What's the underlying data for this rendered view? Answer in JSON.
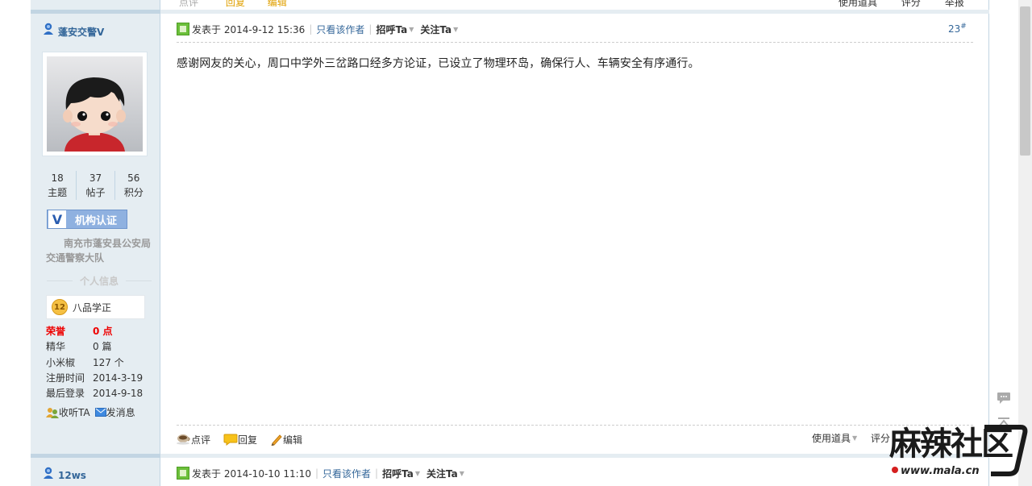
{
  "top_partial": {
    "left_fragments": [
      "点评",
      "回复",
      "编辑"
    ],
    "right_fragments": [
      "使用道具",
      "评分",
      "举报"
    ]
  },
  "post1": {
    "author": {
      "name": "蓬安交警V",
      "stats": [
        {
          "value": "18",
          "label": "主题"
        },
        {
          "value": "37",
          "label": "帖子"
        },
        {
          "value": "56",
          "label": "积分"
        }
      ],
      "verify_badge": "V",
      "verify_label": "机构认证",
      "org": "南充市蓬安县公安局交通警察大队",
      "section_title": "个人信息",
      "rank_level": "12",
      "rank_title": "八品学正",
      "info": [
        {
          "k": "荣誉",
          "v": "0 点",
          "highlight": true
        },
        {
          "k": "精华",
          "v": "0 篇"
        },
        {
          "k": "小米椒",
          "v": "127 个"
        },
        {
          "k": "注册时间",
          "v": "2014-3-19"
        },
        {
          "k": "最后登录",
          "v": "2014-9-18"
        }
      ],
      "listen_label": "收听TA",
      "message_label": "发消息"
    },
    "header": {
      "posted_prefix": "发表于 2014-9-12 15:36",
      "only_author": "只看该作者",
      "greet": "招呼Ta",
      "follow": "关注Ta",
      "floor": "23",
      "floor_mark": "#"
    },
    "content": "感谢网友的关心，周口中学外三岔路口经多方论证，已设立了物理环岛，确保行人、车辆安全有序通行。",
    "footer": {
      "comment": "点评",
      "reply": "回复",
      "edit": "编辑",
      "tools": "使用道具",
      "rate": "评分"
    }
  },
  "post2": {
    "author": {
      "name": "12ws"
    },
    "header": {
      "posted_prefix": "发表于 2014-10-10 11:10",
      "only_author": "只看该作者",
      "greet": "招呼Ta",
      "follow": "关注Ta"
    }
  },
  "watermark": {
    "brand": "麻辣社区",
    "url": "www.mala.cn"
  },
  "colors": {
    "sidebar_bg": "#e5edf2",
    "border": "#c2d5e3",
    "link": "#336699",
    "verify": "#8fb1e0",
    "honor_red": "#ee0000",
    "brand_red": "#d51f1f"
  }
}
